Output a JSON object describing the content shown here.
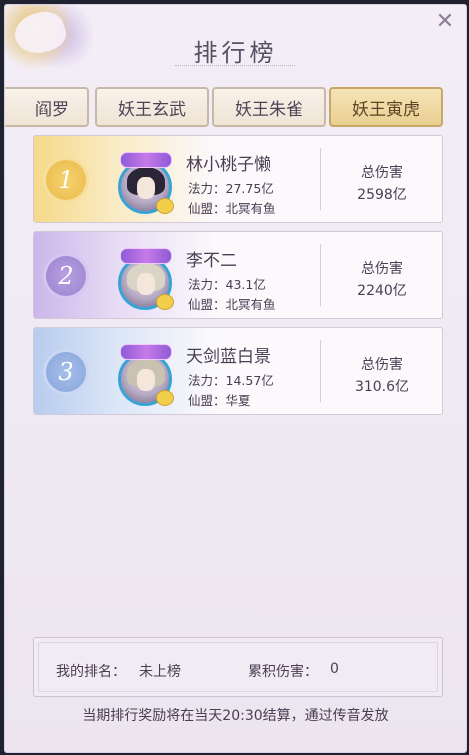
{
  "title": "排行榜",
  "tabs": [
    {
      "label": "阎罗",
      "active": false
    },
    {
      "label": "妖王玄武",
      "active": false
    },
    {
      "label": "妖王朱雀",
      "active": false
    },
    {
      "label": "妖王寅虎",
      "active": true
    }
  ],
  "rows": [
    {
      "rank": "1",
      "name": "林小桃子懒",
      "power_label": "法力：",
      "power": "27.75亿",
      "guild_label": "仙盟：",
      "guild": "北冥有鱼",
      "dmg_label": "总伤害",
      "dmg_value": "2598亿"
    },
    {
      "rank": "2",
      "name": "李不二",
      "power_label": "法力：",
      "power": "43.1亿",
      "guild_label": "仙盟：",
      "guild": "北冥有鱼",
      "dmg_label": "总伤害",
      "dmg_value": "2240亿"
    },
    {
      "rank": "3",
      "name": "天剑蓝白景",
      "power_label": "法力：",
      "power": "14.57亿",
      "guild_label": "仙盟：",
      "guild": "华夏",
      "dmg_label": "总伤害",
      "dmg_value": "310.6亿"
    }
  ],
  "my_rank": {
    "label": "我的排名：",
    "value": "未上榜"
  },
  "my_damage": {
    "label": "累积伤害：",
    "value": "0"
  },
  "footer_note": "当期排行奖励将在当天20:30结算，通过传音发放",
  "colors": {
    "rank1": "#e8b84a",
    "rank2": "#9b82d0",
    "rank3": "#87a5dc",
    "active_tab": "#e9cf92"
  }
}
